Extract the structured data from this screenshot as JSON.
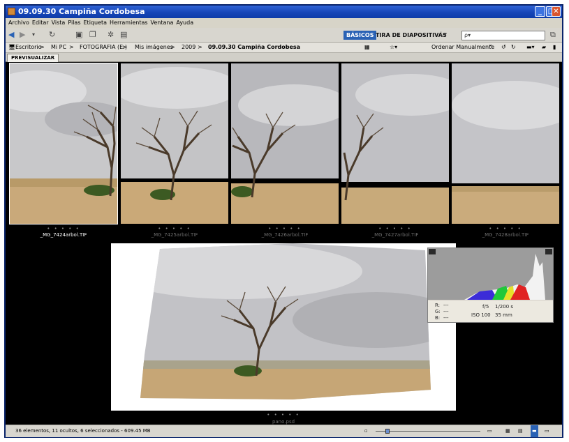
{
  "window": {
    "title": "09.09.30 Campiña Cordobesa",
    "controls": [
      "_",
      "□",
      "✕"
    ]
  },
  "menu": [
    "Archivo",
    "Editar",
    "Vista",
    "Pilas",
    "Etiqueta",
    "Herramientas",
    "Ventana",
    "Ayuda"
  ],
  "toolbar": {
    "workspace_active": "BÁSICOS",
    "workspace_other": "TIRA DE DIAPOSITIVAS",
    "search_placeholder": "ρ▾"
  },
  "path": {
    "items": [
      "Escritorio",
      "Mi PC",
      "FOTOGRAFIA (E:)",
      "Mis imágenes",
      "2009",
      "09.09.30 Campiña Cordobesa"
    ],
    "sort_label": "Ordenar Manualmente"
  },
  "tab": {
    "label": "PREVISUALIZAR"
  },
  "thumbnails": [
    {
      "name": "_MG_7424arbol.TIF",
      "rating": "• • • • •",
      "selected": true
    },
    {
      "name": "_MG_7425arbol.TIF",
      "rating": "• • • • •",
      "selected": false
    },
    {
      "name": "_MG_7426arbol.TIF",
      "rating": "• • • • •",
      "selected": false
    },
    {
      "name": "_MG_7427arbol.TIF",
      "rating": "• • • • •",
      "selected": false
    },
    {
      "name": "_MG_7428arbol.TIF",
      "rating": "• • • • •",
      "selected": false
    }
  ],
  "preview": {
    "name": "pano.psd",
    "rating": "• • • • •"
  },
  "histogram": {
    "r_label": "R:",
    "r_val": "---",
    "g_label": "G:",
    "g_val": "---",
    "b_label": "B:",
    "b_val": "---",
    "aperture": "f/5",
    "shutter": "1/200 s",
    "iso": "ISO 100",
    "focal": "35 mm"
  },
  "status": {
    "text": "36 elementos, 11 ocultos, 6 seleccionados - 609.45 MB"
  }
}
